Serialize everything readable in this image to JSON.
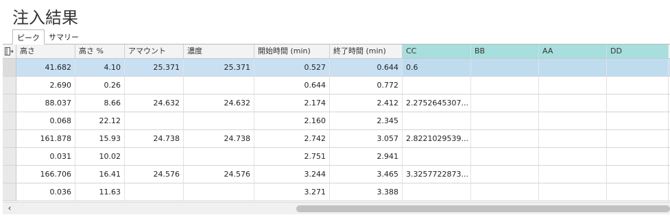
{
  "title": "注入結果",
  "tabs": [
    {
      "label": "ピーク",
      "active": true
    },
    {
      "label": "サマリー",
      "active": false
    }
  ],
  "columns": [
    "高さ",
    "高さ %",
    "アマウント",
    "濃度",
    "開始時間 (min)",
    "終了時間 (min)",
    "CC",
    "BB",
    "AA",
    "DD"
  ],
  "rows": [
    {
      "cells": [
        "41.682",
        "4.10",
        "25.371",
        "25.371",
        "0.527",
        "0.644",
        "0.6",
        "",
        "",
        ""
      ],
      "selected": true
    },
    {
      "cells": [
        "2.690",
        "0.26",
        "",
        "",
        "0.644",
        "0.772",
        "",
        "",
        "",
        ""
      ],
      "selected": false
    },
    {
      "cells": [
        "88.037",
        "8.66",
        "24.632",
        "24.632",
        "2.174",
        "2.412",
        "2.2752645307...",
        "",
        "",
        ""
      ],
      "selected": false
    },
    {
      "cells": [
        "0.068",
        "22.12",
        "",
        "",
        "2.160",
        "2.345",
        "",
        "",
        "",
        ""
      ],
      "selected": false
    },
    {
      "cells": [
        "161.878",
        "15.93",
        "24.738",
        "24.738",
        "2.742",
        "3.057",
        "2.8221029539...",
        "",
        "",
        ""
      ],
      "selected": false
    },
    {
      "cells": [
        "0.031",
        "10.02",
        "",
        "",
        "2.751",
        "2.941",
        "",
        "",
        "",
        ""
      ],
      "selected": false
    },
    {
      "cells": [
        "166.706",
        "16.41",
        "24.576",
        "24.576",
        "3.244",
        "3.465",
        "3.3257722873...",
        "",
        "",
        ""
      ],
      "selected": false
    },
    {
      "cells": [
        "0.036",
        "11.63",
        "",
        "",
        "3.271",
        "3.388",
        "",
        "",
        "",
        ""
      ],
      "selected": false
    }
  ],
  "icons": {
    "column_chooser": "column-chooser-icon",
    "scroll_left": "chevron-left-icon"
  },
  "colors": {
    "accent_header": "#a8dedd",
    "selected_row": "#c9e0f3"
  },
  "scroll_left_glyph": "‹"
}
